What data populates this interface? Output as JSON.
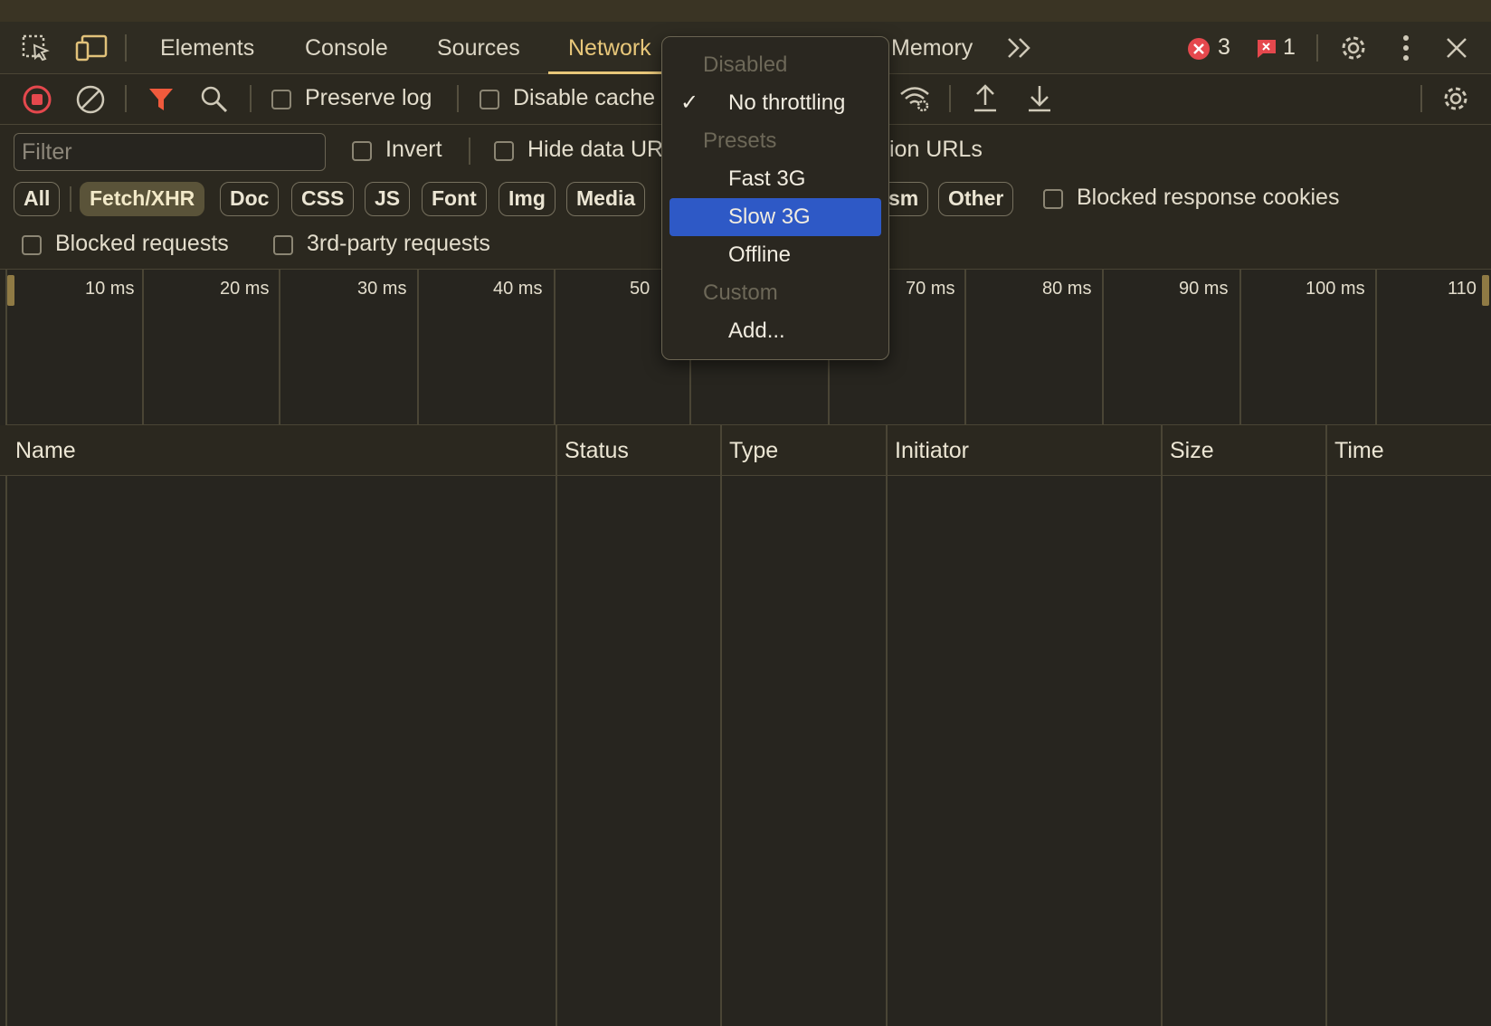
{
  "tabs": [
    {
      "label": "Elements"
    },
    {
      "label": "Console"
    },
    {
      "label": "Sources"
    },
    {
      "label": "Network"
    },
    {
      "label": "Memory"
    }
  ],
  "badges": {
    "errors": "3",
    "issues": "1"
  },
  "toolbar": {
    "preserve_log": "Preserve log",
    "disable_cache": "Disable cache"
  },
  "filter": {
    "placeholder": "Filter",
    "invert": "Invert",
    "hide_data_urls": "Hide data URLs",
    "hide_extension_urls": "ion URLs",
    "blocked_response_cookies": "Blocked response cookies",
    "blocked_requests": "Blocked requests",
    "third_party": "3rd-party requests"
  },
  "chips": [
    "All",
    "Fetch/XHR",
    "Doc",
    "CSS",
    "JS",
    "Font",
    "Img",
    "Media",
    "sm",
    "Other"
  ],
  "active_chip": "Fetch/XHR",
  "timeline": [
    "10 ms",
    "20 ms",
    "30 ms",
    "40 ms",
    "50",
    "70 ms",
    "80 ms",
    "90 ms",
    "100 ms",
    "110"
  ],
  "columns": [
    "Name",
    "Status",
    "Type",
    "Initiator",
    "Size",
    "Time"
  ],
  "throttle_menu": {
    "disabled": "Disabled",
    "no_throttling": "No throttling",
    "presets": "Presets",
    "fast3g": "Fast 3G",
    "slow3g": "Slow 3G",
    "offline": "Offline",
    "custom": "Custom",
    "add": "Add...",
    "checked": "No throttling",
    "highlighted": "Slow 3G"
  },
  "colors": {
    "accent": "#e8c77a",
    "record": "#e5484d",
    "filter": "#f05a3c",
    "selection": "#2e59c6",
    "background": "#27251f"
  }
}
